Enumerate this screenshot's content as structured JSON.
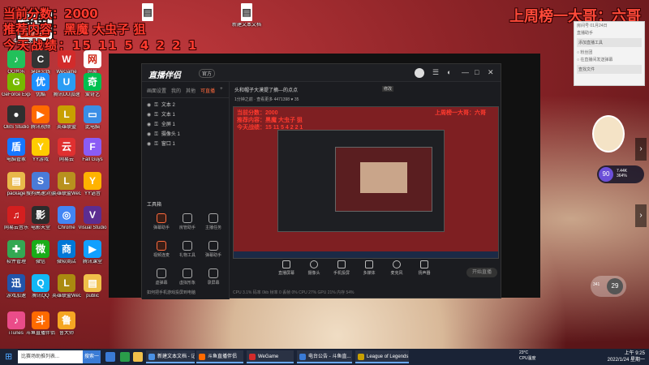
{
  "overlay": {
    "top_left_line1": "当前分数：2000",
    "top_left_line2": "推荐内容：黑魔 大虫子 狙",
    "top_left_line3": "今天战绩：15 11 5 4 2 2 1",
    "top_right": "上周榜一大哥：六哥",
    "logo_text": "斗鱼",
    "logo_sub": "房间号",
    "room_number": "4471398"
  },
  "desktop_icons": [
    {
      "label": "QQ音乐",
      "color": "#22c05a",
      "glyph": "♪"
    },
    {
      "label": "穿越火线",
      "color": "#333333",
      "glyph": "C"
    },
    {
      "label": "WeGame",
      "color": "#d22b2b",
      "glyph": "W"
    },
    {
      "label": "网易",
      "color": "#ffffff",
      "glyph": "网"
    },
    {
      "label": "GeForce Experience",
      "color": "#76b900",
      "glyph": "G"
    },
    {
      "label": "优酷",
      "color": "#1e90ff",
      "glyph": "优"
    },
    {
      "label": "腾讯UU加速",
      "color": "#2a9df4",
      "glyph": "U"
    },
    {
      "label": "爱奇艺",
      "color": "#00c050",
      "glyph": "奇"
    },
    {
      "label": "OBS Studio",
      "color": "#2f2f2f",
      "glyph": "●"
    },
    {
      "label": "腾讯视频",
      "color": "#ff6a00",
      "glyph": "▶"
    },
    {
      "label": "英雄联盟",
      "color": "#c8a000",
      "glyph": "L"
    },
    {
      "label": "此电脑",
      "color": "#3a8ee6",
      "glyph": "▭"
    },
    {
      "label": "电脑管家",
      "color": "#1677ff",
      "glyph": "盾"
    },
    {
      "label": "YY游戏",
      "color": "#ffcc00",
      "glyph": "Y"
    },
    {
      "label": "网易云",
      "color": "#e03030",
      "glyph": "云"
    },
    {
      "label": "Fall Guys",
      "color": "#8a5cf5",
      "glyph": "F"
    },
    {
      "label": "package",
      "color": "#e8b84a",
      "glyph": "▤"
    },
    {
      "label": "搜狗高速浏览器",
      "color": "#4a7bd8",
      "glyph": "S"
    },
    {
      "label": "英雄联盟WeGame",
      "color": "#b8911e",
      "glyph": "L"
    },
    {
      "label": "YY语音",
      "color": "#ffb300",
      "glyph": "Y"
    },
    {
      "label": "网易云音乐",
      "color": "#d41f1f",
      "glyph": "♫"
    },
    {
      "label": "电影天堂",
      "color": "#2c2c2c",
      "glyph": "影"
    },
    {
      "label": "Chrome",
      "color": "#4285f4",
      "glyph": "◎"
    },
    {
      "label": "Visual Studio",
      "color": "#5c2d91",
      "glyph": "V"
    },
    {
      "label": "软件管理",
      "color": "#34a853",
      "glyph": "✚"
    },
    {
      "label": "微信",
      "color": "#1aad19",
      "glyph": "微"
    },
    {
      "label": "微软商店",
      "color": "#0078d7",
      "glyph": "商"
    },
    {
      "label": "腾讯课堂",
      "color": "#10a0ff",
      "glyph": "▶"
    },
    {
      "label": "游戏加速",
      "color": "#2255aa",
      "glyph": "迅"
    },
    {
      "label": "腾讯QQ",
      "color": "#12b7f5",
      "glyph": "Q"
    },
    {
      "label": "英雄联盟WeGame版",
      "color": "#aa8a10",
      "glyph": "L"
    },
    {
      "label": "public",
      "color": "#f0c04a",
      "glyph": "▤"
    },
    {
      "label": "iTunes",
      "color": "#ea4c89",
      "glyph": "♪"
    },
    {
      "label": "斗鱼直播伴侣",
      "color": "#ff6a00",
      "glyph": "斗"
    },
    {
      "label": "鲁大师",
      "color": "#f5a623",
      "glyph": "鲁"
    }
  ],
  "top_desktop_files": [
    {
      "label": "新建文本文档"
    }
  ],
  "app": {
    "logo": "直播伴侣",
    "tag": "官方",
    "tabs": [
      "画面设置",
      "我的",
      "其他",
      "可直播"
    ],
    "active_tab_index": 3,
    "sources": [
      "文本 2",
      "文本 1",
      "全屏 1",
      "摄像头 1",
      "窗口 1"
    ],
    "tools_title": "工具箱",
    "tools": [
      "弹幕助手",
      "房管助手",
      "主播任务",
      "视频连麦",
      "礼物工具",
      "弹幕助手",
      "虚弹幕",
      "虚拟形象",
      "录屏幕"
    ],
    "tip": "如何把手机游戏投屏到电脑",
    "stage_title": "头和帽子大漠提了摘---的点点",
    "stage_tag": "修改",
    "stage_info": "1分钟之前 · 查看更多  4471398  ♥ 35",
    "bottom_buttons": [
      "直播屏幕",
      "摄像头",
      "手机投屏",
      "多媒体",
      "麦克风",
      "扬声器"
    ],
    "start_live": "开始直播",
    "status_line": "CPU 3.1%   码率 0kb   帧率 0   丢帧 0%   CPU 27%   GPU 21%   内存 54%"
  },
  "chat": {
    "rows": [
      "房间号 01月24日",
      "直播助手",
      "● 添加直播工具",
      "○ 粉丝团",
      "○ 在直播间发送弹幕",
      "○ 搜索弹幕，查找文件"
    ],
    "buttons": [
      "添加直播工具",
      "查找文件"
    ]
  },
  "widgets": {
    "gauge_value": "90",
    "gauge_text_line1": "7.44K",
    "gauge_text_line2": "364%",
    "gauge2_value": "29",
    "gauge2_text": "341"
  },
  "taskbar": {
    "search_placeholder": "比赛场助推列表...",
    "search_button": "搜索一下",
    "items": [
      {
        "label": "新建文本文档 - 记...",
        "color": "#4a90e2"
      },
      {
        "label": "斗鱼直播伴侣",
        "color": "#ff6a00"
      },
      {
        "label": "WeGame",
        "color": "#d22b2b"
      },
      {
        "label": "电台公告 - 斗鱼直...",
        "color": "#3a7bd5"
      },
      {
        "label": "League of Legends",
        "color": "#c8a000"
      }
    ],
    "tray_line1": "23°C",
    "tray_line2": "CPU温度",
    "time": "上午 9:25",
    "date": "2022/1/24 星期一"
  }
}
